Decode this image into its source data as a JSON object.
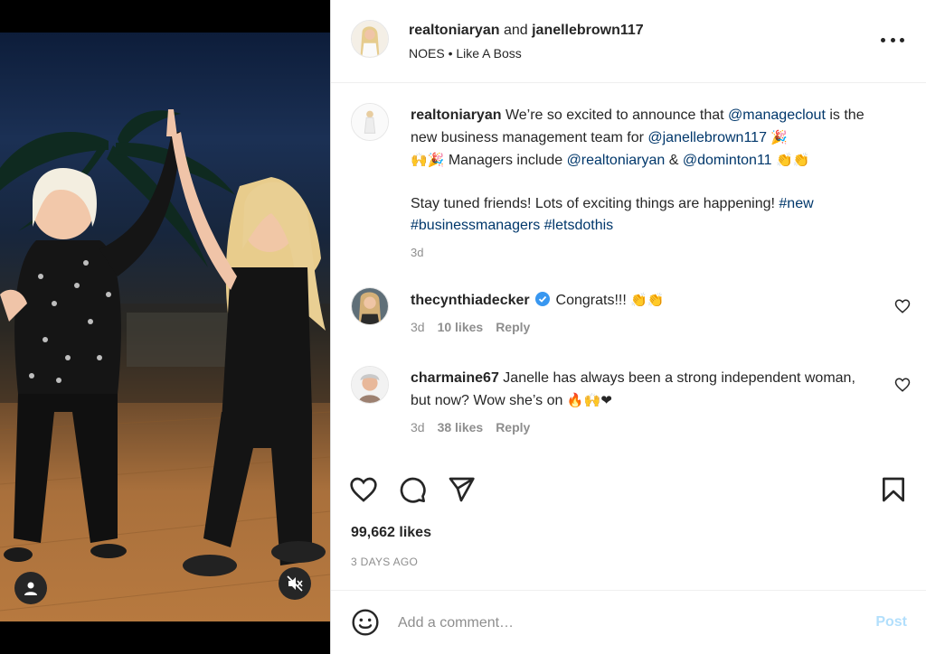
{
  "post": {
    "header": {
      "user1": "realtoniaryan",
      "joiner": "and",
      "user2": "janellebrown117",
      "audio_artist": "NOES",
      "separator": "•",
      "audio_track": "Like A Boss",
      "more_icon": "more-options-icon"
    },
    "media": {
      "user_tag_icon": "person-icon",
      "mute_icon": "speaker-muted-icon"
    },
    "caption": {
      "username": "realtoniaryan",
      "text_1": "We’re so excited to announce that",
      "mention_1": "@manageclout",
      "text_2": "is the new business management team for",
      "mention_2": "@janellebrown117",
      "emoji_1": "🎉",
      "emoji_2": "🙌🎉",
      "text_3": "Managers include",
      "mention_3": "@realtoniaryan",
      "text_4": "&",
      "mention_4": "@dominton11",
      "emoji_3": "👏👏",
      "text_5": "Stay tuned friends! Lots of exciting things are happening!",
      "hashtag_1": "#new",
      "hashtag_2": "#businessmanagers",
      "hashtag_3": "#letsdothis",
      "time": "3d"
    },
    "comments": [
      {
        "username": "thecynthiadecker",
        "verified": true,
        "text": "Congrats!!!",
        "emoji": "👏👏",
        "time": "3d",
        "likes": "10 likes",
        "reply": "Reply"
      },
      {
        "username": "charmaine67",
        "verified": false,
        "text": "Janelle has always been a strong independent woman, but now? Wow she’s on",
        "emoji": "🔥🙌❤",
        "time": "3d",
        "likes": "38 likes",
        "reply": "Reply"
      }
    ],
    "actions": {
      "like_icon": "heart-icon",
      "comment_icon": "comment-icon",
      "share_icon": "share-icon",
      "save_icon": "bookmark-icon"
    },
    "likes": "99,662 likes",
    "date": "3 DAYS AGO",
    "comment_box": {
      "emoji_icon": "smiley-icon",
      "placeholder": "Add a comment…",
      "post_label": "Post"
    },
    "colors": {
      "link": "#00376b",
      "secondary_text": "#8e8e8e",
      "post_disabled": "#b2dffc",
      "verified": "#3897f0",
      "heart": "#ed4956"
    }
  }
}
